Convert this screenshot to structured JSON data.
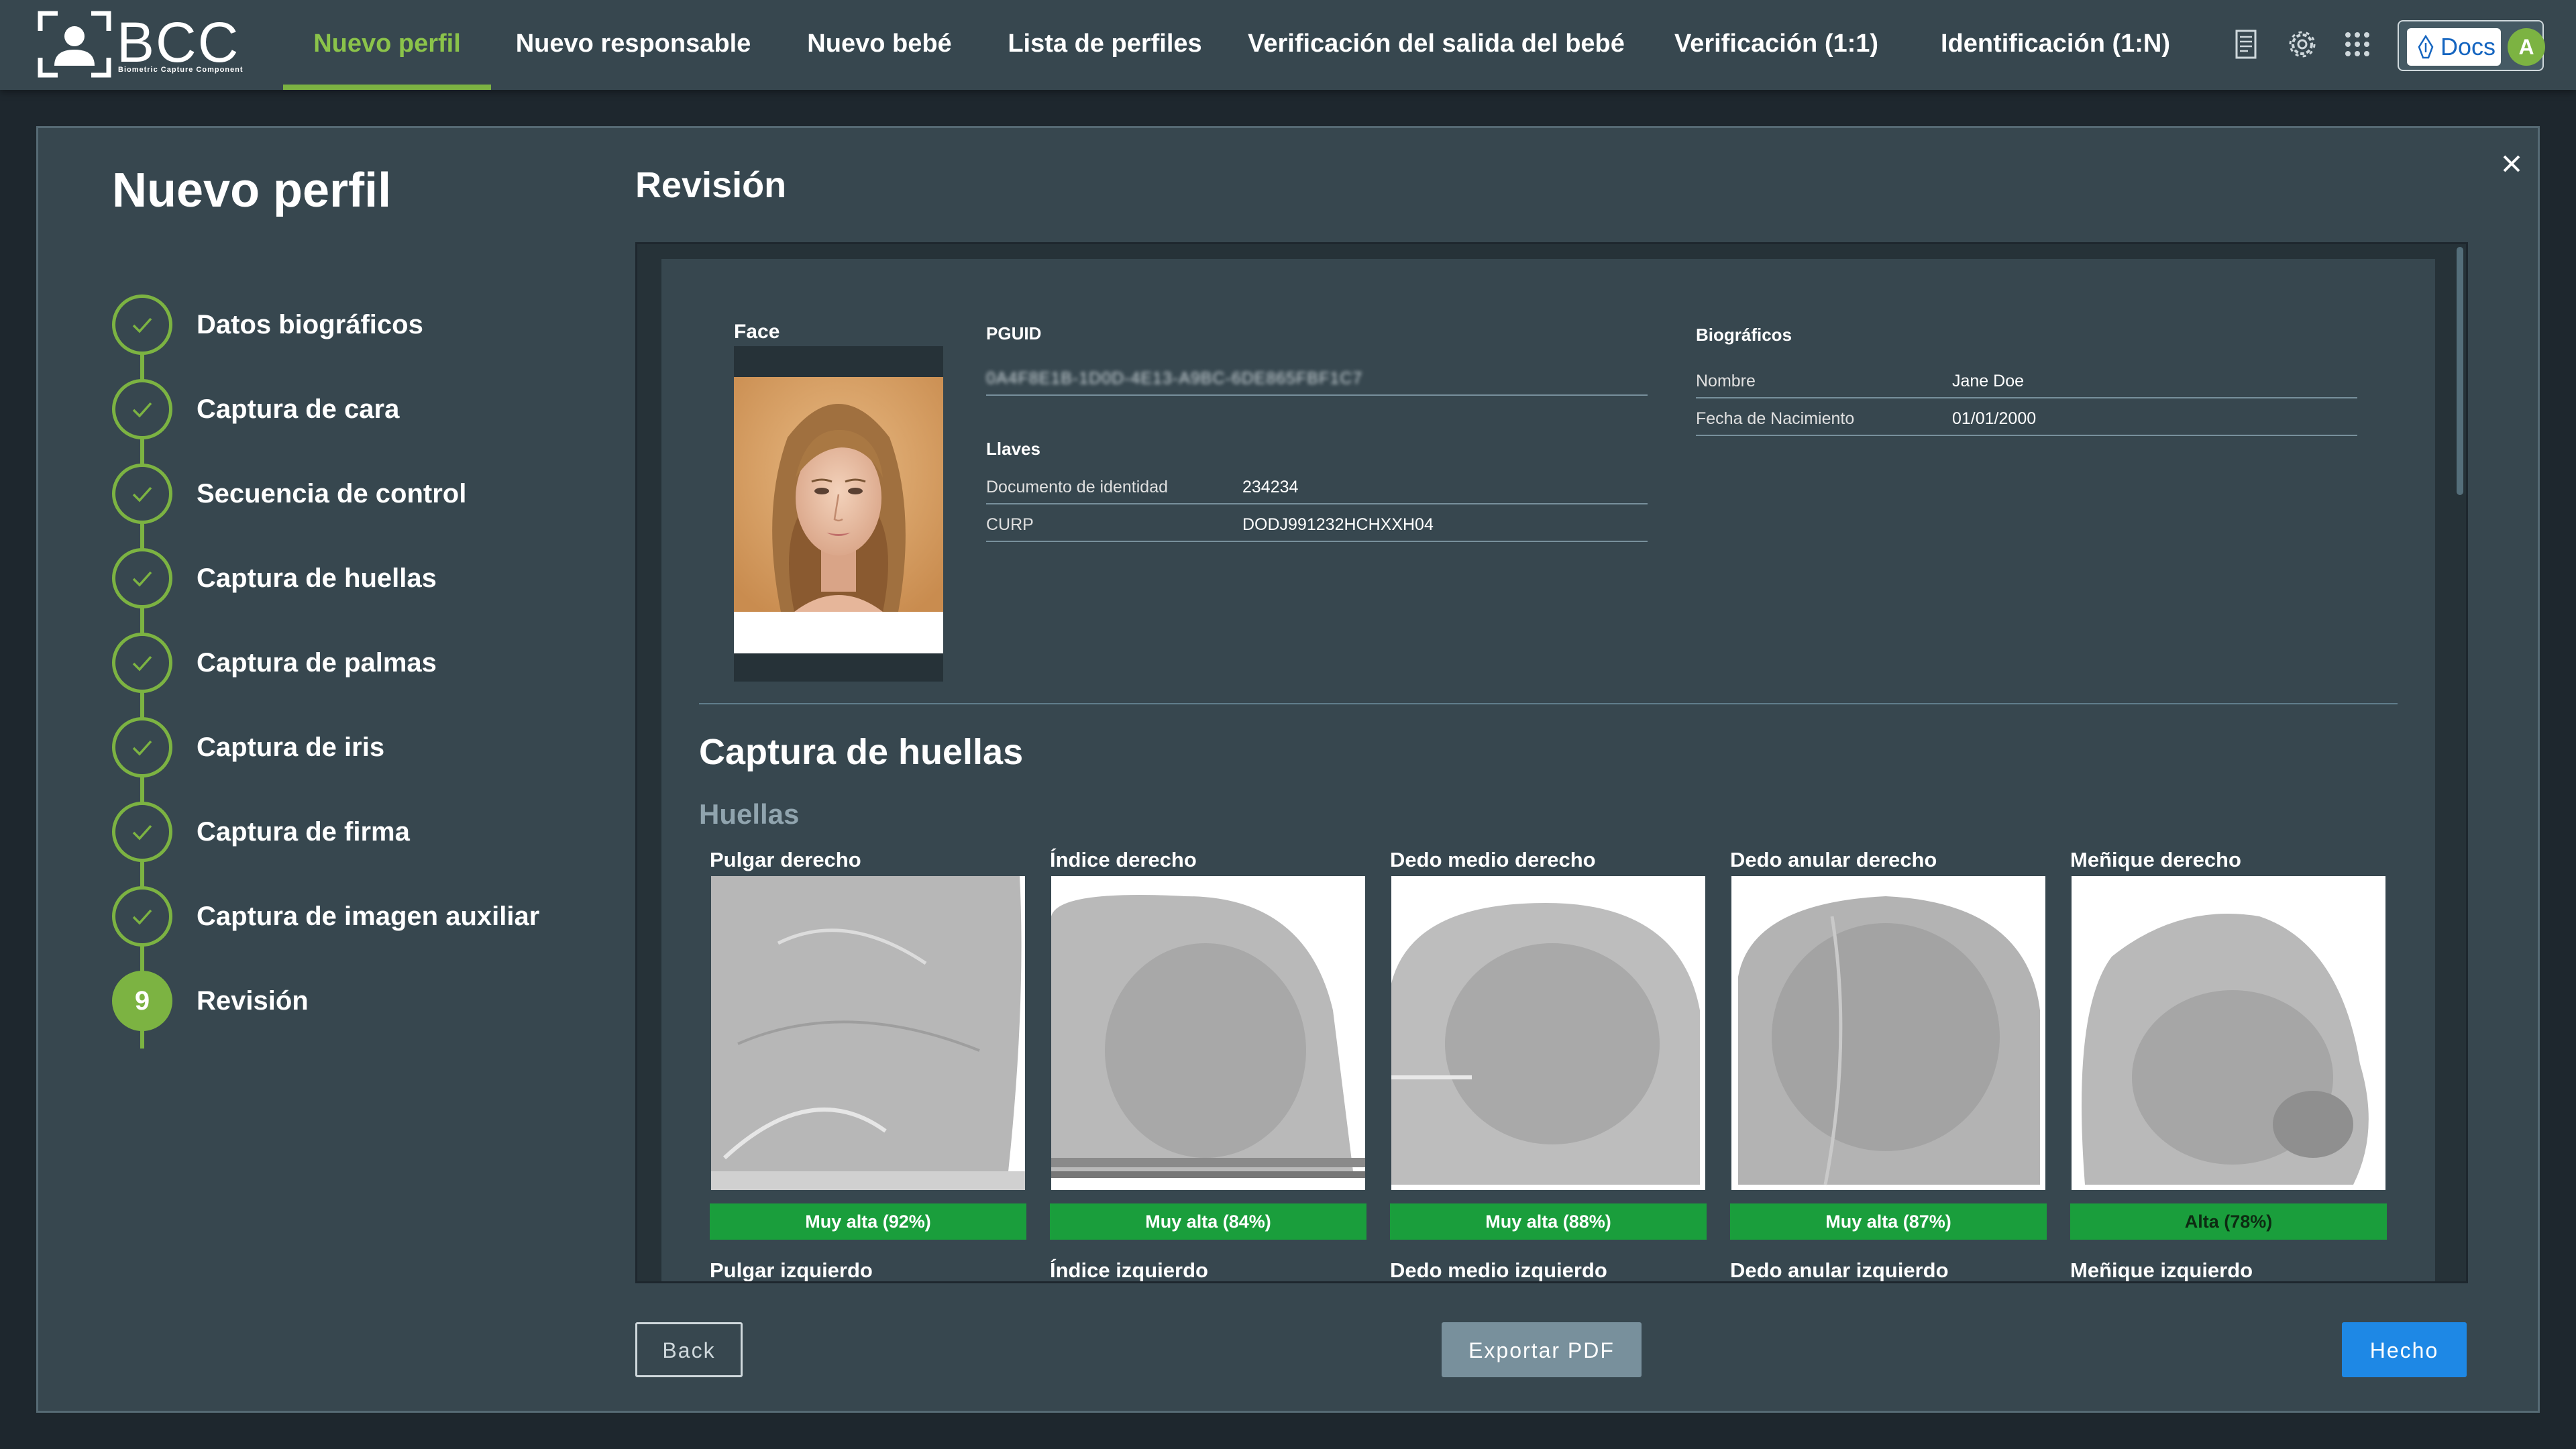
{
  "app": {
    "logo_text": "BCC",
    "logo_subtitle": "Biometric Capture Component"
  },
  "nav": {
    "items": [
      {
        "label": "Nuevo perfil",
        "active": true
      },
      {
        "label": "Nuevo responsable",
        "active": false
      },
      {
        "label": "Nuevo bebé",
        "active": false
      },
      {
        "label": "Lista de perfiles",
        "active": false
      },
      {
        "label": "Verificación del salida del bebé",
        "active": false
      },
      {
        "label": "Verificación (1:1)",
        "active": false
      },
      {
        "label": "Identificación (1:N)",
        "active": false
      }
    ],
    "icons": [
      "document-icon",
      "gear-icon",
      "apps-grid-icon"
    ],
    "docs_label": "Docs",
    "avatar_letter": "A",
    "accent_color": "#8bc34a"
  },
  "modal": {
    "title": "Nuevo perfil",
    "steps": [
      {
        "label": "Datos biográficos",
        "status": "done"
      },
      {
        "label": "Captura de cara",
        "status": "done"
      },
      {
        "label": "Secuencia de control",
        "status": "done"
      },
      {
        "label": "Captura de huellas",
        "status": "done"
      },
      {
        "label": "Captura de palmas",
        "status": "done"
      },
      {
        "label": "Captura de iris",
        "status": "done"
      },
      {
        "label": "Captura de firma",
        "status": "done"
      },
      {
        "label": "Captura de imagen auxiliar",
        "status": "done"
      },
      {
        "label": "Revisión",
        "status": "current",
        "number": "9"
      }
    ]
  },
  "review": {
    "title": "Revisión",
    "face_label": "Face",
    "pguid_label": "PGUID",
    "pguid_value": "0A4F8E1B-1D0D-4E13-A9BC-6DE865FBF1C7",
    "keys_label": "Llaves",
    "keys": [
      {
        "key": "Documento de identidad",
        "value": "234234"
      },
      {
        "key": "CURP",
        "value": "DODJ991232HCHXXH04"
      }
    ],
    "bio_label": "Biográficos",
    "bio": [
      {
        "key": "Nombre",
        "value": "Jane Doe"
      },
      {
        "key": "Fecha de Nacimiento",
        "value": "01/01/2000"
      }
    ],
    "fingers_section_title": "Captura de huellas",
    "fingers_subtitle": "Huellas",
    "fingers_right": [
      {
        "label": "Pulgar derecho",
        "quality": "Muy alta (92%)"
      },
      {
        "label": "Índice derecho",
        "quality": "Muy alta (84%)"
      },
      {
        "label": "Dedo medio derecho",
        "quality": "Muy alta (88%)"
      },
      {
        "label": "Dedo anular derecho",
        "quality": "Muy alta (87%)"
      },
      {
        "label": "Meñique derecho",
        "quality": "Alta (78%)"
      }
    ],
    "fingers_left": [
      {
        "label": "Pulgar izquierdo"
      },
      {
        "label": "Índice izquierdo"
      },
      {
        "label": "Dedo medio izquierdo"
      },
      {
        "label": "Dedo anular izquierdo"
      },
      {
        "label": "Meñique izquierdo"
      }
    ],
    "quality_color": "#1a9e3c"
  },
  "footer": {
    "back_label": "Back",
    "export_label": "Exportar PDF",
    "done_label": "Hecho"
  }
}
